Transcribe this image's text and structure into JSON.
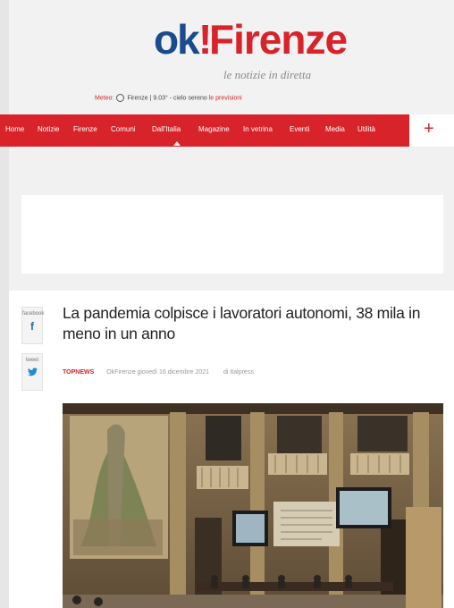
{
  "header": {
    "logo_ok": "ok",
    "logo_bang": "!",
    "logo_firenze": "Firenze",
    "tagline": "le notizie in diretta",
    "weather": {
      "label": "Meteo:",
      "city": "Firenze",
      "temp": "9.03°",
      "condition": "cielo sereno",
      "link": "le previsioni"
    }
  },
  "nav": {
    "items": [
      "Home",
      "Notizie",
      "Firenze",
      "Comuni",
      "Dall'Italia",
      "Magazine",
      "In vetrina",
      "Eventi",
      "Media",
      "Utilità"
    ],
    "plus": "+"
  },
  "share": {
    "facebook_label": "facebook",
    "facebook_icon": "f",
    "twitter_label": "tweet",
    "twitter_icon": "🐦"
  },
  "article": {
    "title": "La pandemia colpisce i lavoratori autonomi, 38 mila in meno in un anno",
    "category": "TOPNEWS",
    "source_date": "OkFirenze giovedì 16 dicembre 2021",
    "author": "di Italpress"
  },
  "colors": {
    "brand_red": "#d8232a",
    "brand_blue": "#1a4b8c"
  }
}
